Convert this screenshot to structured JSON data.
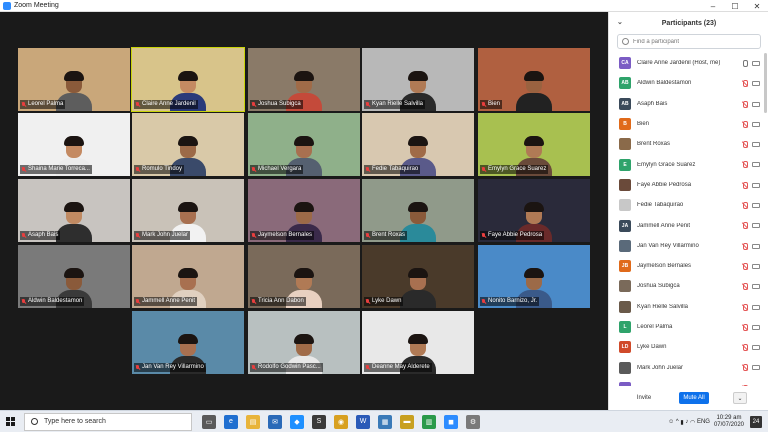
{
  "window": {
    "title": "Zoom Meeting"
  },
  "grid": {
    "tiles": [
      {
        "name": "Leorel Palma",
        "scene": "#c9a77a",
        "skin": "#8a5a3a",
        "shirt": "#5d5d5d"
      },
      {
        "name": "Claire Anne Jardenil",
        "scene": "#d8c48a",
        "skin": "#c48a62",
        "shirt": "#2a3a7a",
        "active": true
      },
      {
        "name": "Joshua Subigca",
        "scene": "#8a7a68",
        "skin": "#a06b48",
        "shirt": "#c44a3a"
      },
      {
        "name": "Kyan Rielle Salvilla",
        "scene": "#b8b8b8",
        "skin": "#b07a55",
        "shirt": "#2a2a2a"
      },
      {
        "name": "Bien",
        "scene": "#b06040",
        "skin": "#9a6240",
        "shirt": "#222222"
      },
      {
        "name": "Shaina Marie Torreca...",
        "scene": "#f0f0f0",
        "skin": "#c48a62",
        "shirt": "#ececec"
      },
      {
        "name": "Romulo Tindoy",
        "scene": "#d9c9a8",
        "skin": "#9c6a48",
        "shirt": "#3a4a6a"
      },
      {
        "name": "Michael Vergara",
        "scene": "#8fb08a",
        "skin": "#a87050",
        "shirt": "#556070"
      },
      {
        "name": "Fedie Tabaquirao",
        "scene": "#d8c8b0",
        "skin": "#a06b48",
        "shirt": "#5a5a8a"
      },
      {
        "name": "Emylyn Grace Suarez",
        "scene": "#a8c050",
        "skin": "#b07a55",
        "shirt": "#6a4a3a"
      },
      {
        "name": "Asaph Bais",
        "scene": "#c8c4c0",
        "skin": "#c08a62",
        "shirt": "#2e2e2e"
      },
      {
        "name": "Mark John Juelar",
        "scene": "#c9c2b8",
        "skin": "#a87050",
        "shirt": "#f2f2f2"
      },
      {
        "name": "Jaymelson Bernales",
        "scene": "#8a6a7a",
        "skin": "#9c6a48",
        "shirt": "#3a2a4a"
      },
      {
        "name": "Brent Roxas",
        "scene": "#909a8a",
        "skin": "#8a5a3a",
        "shirt": "#2a8a9a"
      },
      {
        "name": "Faye Abbie Pedrosa",
        "scene": "#2a2a3a",
        "skin": "#b07a55",
        "shirt": "#6a2a2a"
      },
      {
        "name": "Aldwin Baldestamon",
        "scene": "#7a7a7a",
        "skin": "#8a5a3a",
        "shirt": "#3a3a3a"
      },
      {
        "name": "Jammell Anne Penit",
        "scene": "#c0a890",
        "skin": "#a87050",
        "shirt": "#e0d0c0"
      },
      {
        "name": "Tricia Ann Dabon",
        "scene": "#7a6a5a",
        "skin": "#b07a55",
        "shirt": "#e8d0c0"
      },
      {
        "name": "Lyke Dawn",
        "scene": "#4a3a2a",
        "skin": "#a87050",
        "shirt": "#2a2a2a"
      },
      {
        "name": "Nonito Barnizo, Jr.",
        "scene": "#4a8ac8",
        "skin": "#9c6a48",
        "shirt": "#3a5a8a"
      },
      {
        "name": "Jan Van Rey Villarmino",
        "scene": "#5a8aa8",
        "skin": "#a87050",
        "shirt": "#2a2a2a"
      },
      {
        "name": "Rodolfo Godwin Pasc...",
        "scene": "#b8c0c0",
        "skin": "#a06b48",
        "shirt": "#e8e8e8"
      },
      {
        "name": "Deanne May Alderete",
        "scene": "#e8e8e8",
        "skin": "#b07a55",
        "shirt": "#2a2a2a"
      }
    ]
  },
  "panel": {
    "title": "Participants (23)",
    "search_placeholder": "Find a participant",
    "participants": [
      {
        "initials": "CA",
        "color": "#7b5cc4",
        "name": "Claire Anne Jardenil (Host, me)",
        "muted": false
      },
      {
        "initials": "AB",
        "color": "#2fa36b",
        "name": "Aldwin Baldestamon",
        "muted": true
      },
      {
        "initials": "AB",
        "color": "#3a4a5a",
        "name": "Asaph Bais",
        "muted": true
      },
      {
        "initials": "B",
        "color": "#e06a1a",
        "name": "Bien",
        "muted": true
      },
      {
        "initials": "",
        "color": "#8a6a4a",
        "name": "Brent Roxas",
        "muted": true
      },
      {
        "initials": "E",
        "color": "#2fa36b",
        "name": "Emylyn Grace Suarez",
        "muted": true
      },
      {
        "initials": "",
        "color": "#6a4a3a",
        "name": "Faye Abbie Pedrosa",
        "muted": true
      },
      {
        "initials": "",
        "color": "#c8c8c8",
        "name": "Fedie Tabaquirao",
        "muted": true
      },
      {
        "initials": "JA",
        "color": "#3a4a5a",
        "name": "Jammell Anne Penit",
        "muted": true
      },
      {
        "initials": "",
        "color": "#5a6a7a",
        "name": "Jan Van Rey Villarmino",
        "muted": true
      },
      {
        "initials": "JB",
        "color": "#e06a1a",
        "name": "Jaymelson Bernales",
        "muted": true
      },
      {
        "initials": "",
        "color": "#7a6a5a",
        "name": "Joshua Subigca",
        "muted": true
      },
      {
        "initials": "",
        "color": "#6a5a4a",
        "name": "Kyan Rielle Salvilla",
        "muted": true
      },
      {
        "initials": "L",
        "color": "#2fa36b",
        "name": "Leorel Palma",
        "muted": true
      },
      {
        "initials": "LD",
        "color": "#d04a2a",
        "name": "Lyke Dawn",
        "muted": true
      },
      {
        "initials": "",
        "color": "#5a5a5a",
        "name": "Mark John Juelar",
        "muted": true
      },
      {
        "initials": "",
        "color": "#7b5cc4",
        "name": "",
        "muted": true
      }
    ],
    "invite_label": "Invite",
    "mute_all_label": "Mute All",
    "more_label": "⌄"
  },
  "taskbar": {
    "search_placeholder": "Type here to search",
    "time": "10:29 am",
    "date": "07/07/2020",
    "language": "ENG",
    "notifications": "24"
  }
}
